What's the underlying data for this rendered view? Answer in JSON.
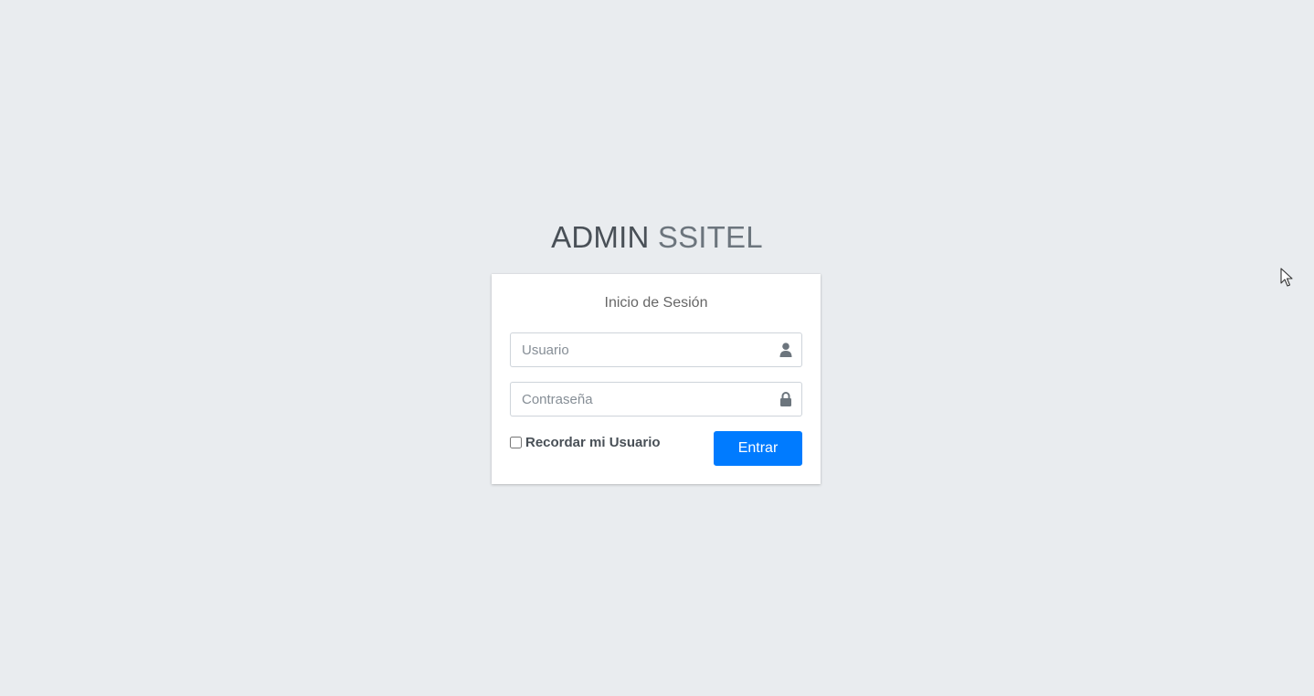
{
  "logo": {
    "bold": "ADMIN",
    "light": "SSITEL"
  },
  "login": {
    "message": "Inicio de Sesión",
    "username_placeholder": "Usuario",
    "username_icon": "user-icon",
    "password_placeholder": "Contraseña",
    "password_icon": "lock-icon",
    "remember_label": "Recordar mi Usuario",
    "remember_checked": false,
    "submit_label": "Entrar"
  },
  "colors": {
    "background": "#e9ecef",
    "primary": "#007bff",
    "card": "#ffffff"
  }
}
